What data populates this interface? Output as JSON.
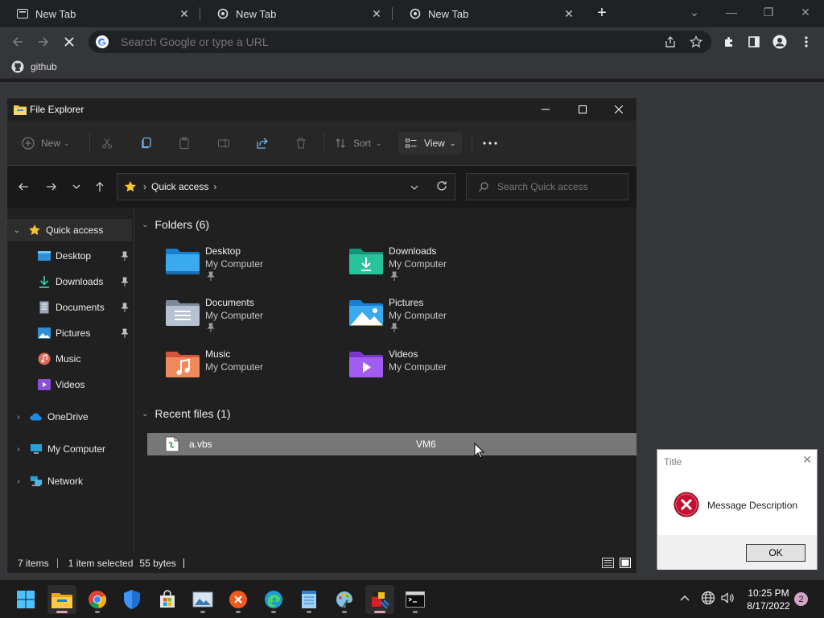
{
  "browser": {
    "tabs": [
      {
        "title": "New Tab"
      },
      {
        "title": "New Tab"
      },
      {
        "title": "New Tab"
      }
    ],
    "omnibox_placeholder": "Search Google or type a URL",
    "bookmarks": [
      {
        "label": "github"
      }
    ]
  },
  "explorer": {
    "title": "File Explorer",
    "commands": {
      "new": "New",
      "sort": "Sort",
      "view": "View"
    },
    "breadcrumb": "Quick access",
    "search_placeholder": "Search Quick access",
    "sidebar": {
      "quick_access": "Quick access",
      "pinned": [
        {
          "label": "Desktop",
          "icon": "desktop-folder-icon"
        },
        {
          "label": "Downloads",
          "icon": "downloads-folder-icon"
        },
        {
          "label": "Documents",
          "icon": "documents-folder-icon"
        },
        {
          "label": "Pictures",
          "icon": "pictures-folder-icon"
        },
        {
          "label": "Music",
          "icon": "music-folder-icon"
        },
        {
          "label": "Videos",
          "icon": "videos-folder-icon"
        }
      ],
      "onedrive": "OneDrive",
      "my_computer": "My Computer",
      "network": "Network"
    },
    "folders_header": "Folders (6)",
    "folders": [
      {
        "name": "Desktop",
        "location": "My Computer"
      },
      {
        "name": "Downloads",
        "location": "My Computer"
      },
      {
        "name": "Documents",
        "location": "My Computer"
      },
      {
        "name": "Pictures",
        "location": "My Computer"
      },
      {
        "name": "Music",
        "location": "My Computer"
      },
      {
        "name": "Videos",
        "location": "My Computer"
      }
    ],
    "recent_header": "Recent files (1)",
    "recent_files": [
      {
        "name": "a.vbs",
        "location": "VM6"
      }
    ],
    "status": {
      "items": "7 items",
      "selected": "1 item selected",
      "size": "55 bytes"
    }
  },
  "message_box": {
    "title": "Title",
    "message": "Message Description",
    "ok_label": "OK"
  },
  "taskbar": {
    "time": "10:25 PM",
    "date": "8/17/2022",
    "notification_count": "2"
  }
}
